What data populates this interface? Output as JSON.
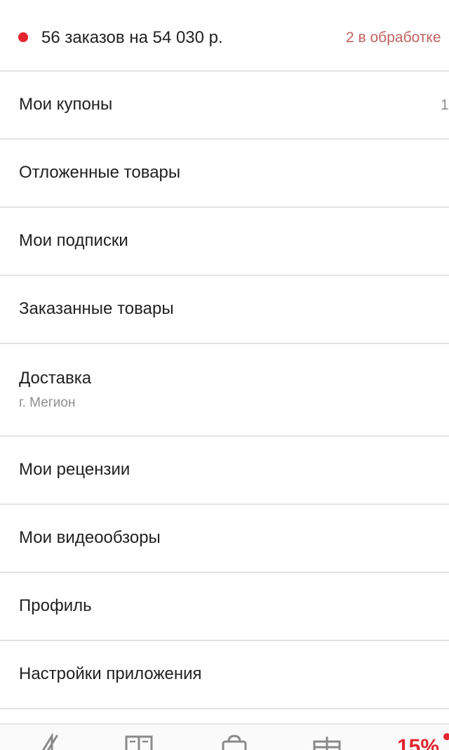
{
  "colors": {
    "accent": "#e3262f",
    "processing_text": "#c0625f",
    "divider": "#e3e3e3",
    "secondary_text": "#8e8e8e",
    "icon": "#8a8a8a"
  },
  "orders": {
    "summary": "56 заказов на 54 030 р.",
    "processing": "2 в обработке"
  },
  "menu": {
    "items": [
      {
        "label": "Мои купоны",
        "count": "1"
      },
      {
        "label": "Отложенные товары"
      },
      {
        "label": "Мои подписки"
      },
      {
        "label": "Заказанные товары"
      },
      {
        "label": "Доставка",
        "sublabel": "г. Мегион"
      },
      {
        "label": "Мои рецензии"
      },
      {
        "label": "Мои видеообзоры"
      },
      {
        "label": "Профиль"
      },
      {
        "label": "Настройки приложения"
      }
    ]
  },
  "tab_bar": {
    "tabs": [
      {
        "icon": "logo-icon"
      },
      {
        "icon": "catalog-book-icon"
      },
      {
        "icon": "cart-bag-icon"
      },
      {
        "icon": "gift-icon"
      }
    ],
    "discount_label": "15%"
  }
}
